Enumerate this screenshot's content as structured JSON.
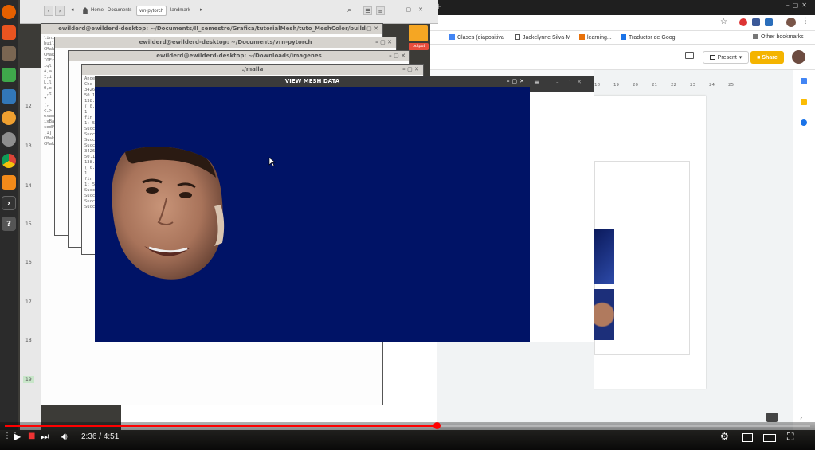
{
  "file_manager": {
    "breadcrumbs": [
      "Home",
      "Documents",
      "vrn-pytorch",
      "landmark"
    ]
  },
  "terminals": [
    {
      "title": "ewilderd@ewilderd-desktop: ~/Documents/II_semestre/Grafica/tutorialMesh/tuto_MeshColor/build"
    },
    {
      "title": "ewilderd@ewilderd-desktop: ~/Documents/vrn-pytorch"
    },
    {
      "title": "ewilderd@ewilderd-desktop: ~/Downloads/imagenes"
    },
    {
      "title": "./malla"
    }
  ],
  "terminal_text": {
    "col_a": [
      "linig",
      "build",
      "CMake",
      "CMake",
      "IOErr",
      "iql:",
      "A,a",
      "I,i",
      "L,l",
      "O,o",
      "T,t",
      "Z",
      "[,",
      "<,>",
      "exampl",
      "ixBas",
      "sedF",
      "[1]",
      "CMake",
      "CMake"
    ],
    "col_c": [
      "Angel",
      "Che",
      "34267",
      "50.1",
      "138.5",
      "( 0.5",
      "1",
      "fin c",
      "1: 57",
      "Succe",
      "Succe",
      "Succe",
      "Succe",
      "34267",
      "50.1",
      "138.5",
      "( 0.5",
      "1",
      "fin c",
      "1: 57",
      "Succe",
      "Succe",
      "Succe",
      "Succe"
    ]
  },
  "folder_label": "output",
  "mesh_window": {
    "title": "VIEW MESH DATA"
  },
  "chrome": {
    "bookmarks": [
      "Clases (diapositiva",
      "Jackelynne Silva-M",
      "learning...",
      "Traductor de Goog",
      "Other bookmarks"
    ],
    "present_label": "Present",
    "share_label": "Share",
    "ruler_ticks": [
      "18",
      "19",
      "20",
      "21",
      "22",
      "23",
      "24",
      "25"
    ]
  },
  "line_numbers": [
    "12",
    "13",
    "14",
    "15",
    "16",
    "17",
    "18",
    "19"
  ],
  "video": {
    "time_current": "2:36",
    "time_total": "4:51",
    "progress": 0.536
  }
}
